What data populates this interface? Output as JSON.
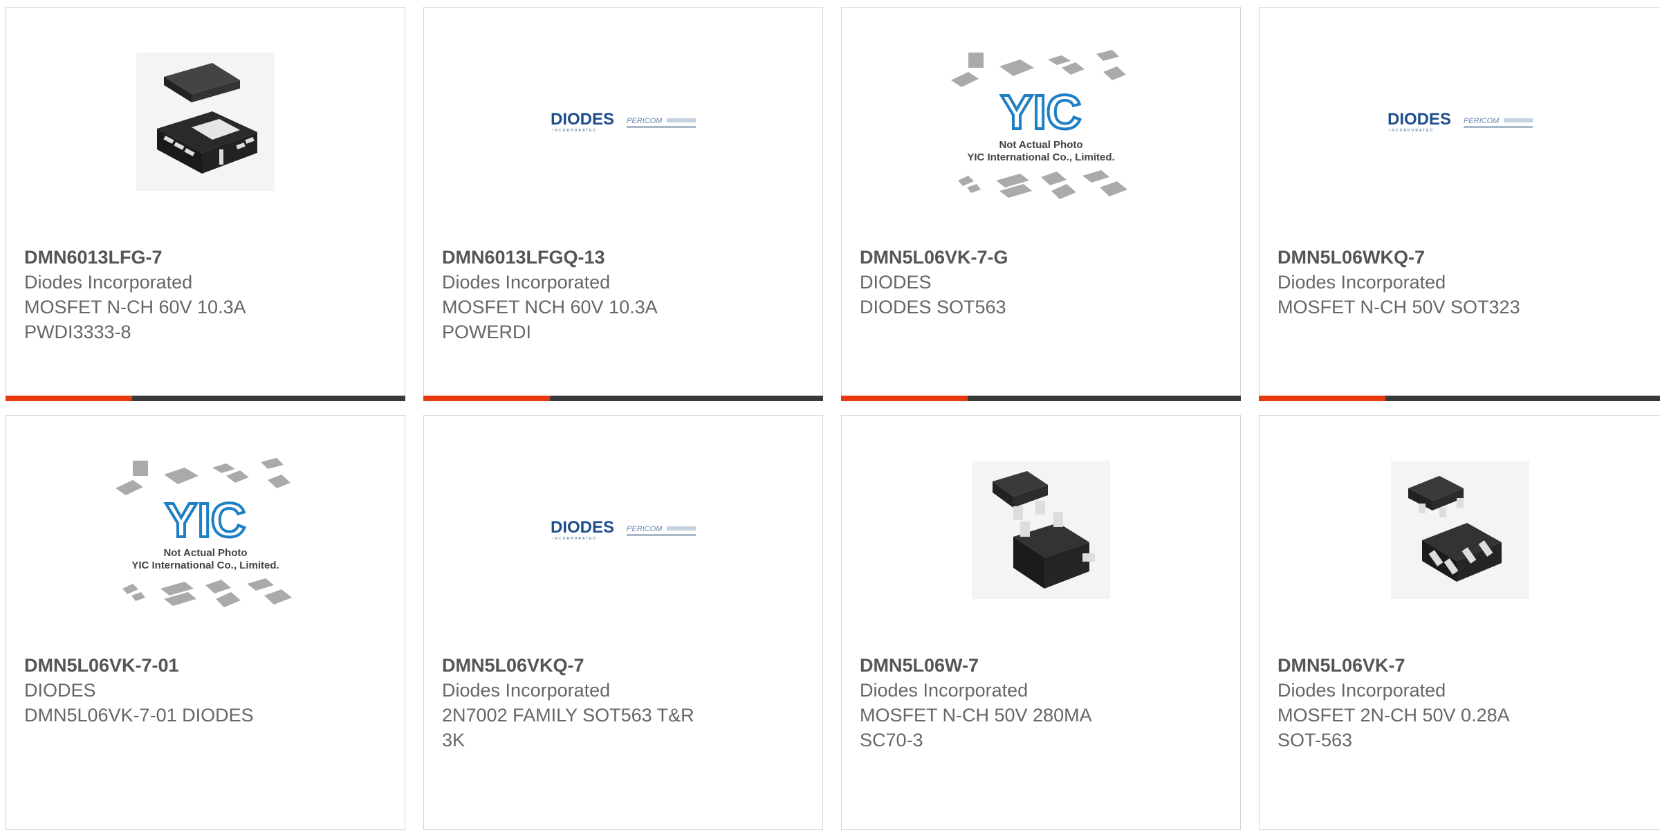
{
  "brand_colors": {
    "accent": "#e8380d",
    "bar": "#3a3a3a",
    "text": "#666666"
  },
  "products": [
    {
      "part": "DMN6013LFG-7",
      "maker": "Diodes Incorporated",
      "desc1": "MOSFET N-CH 60V 10.3A",
      "desc2": "PWDI3333-8",
      "image": "qfn-package-photo"
    },
    {
      "part": "DMN6013LFGQ-13",
      "maker": "Diodes Incorporated",
      "desc1": "MOSFET NCH 60V 10.3A",
      "desc2": "POWERDI",
      "image": "diodes-pericom-logo"
    },
    {
      "part": "DMN5L06VK-7-G",
      "maker": "DIODES",
      "desc1": "DIODES SOT563",
      "desc2": "",
      "image": "yic-not-actual-photo"
    },
    {
      "part": "DMN5L06WKQ-7",
      "maker": "Diodes Incorporated",
      "desc1": "MOSFET N-CH 50V SOT323",
      "desc2": "",
      "image": "diodes-pericom-logo"
    },
    {
      "part": "DMN5L06VK-7-01",
      "maker": "DIODES",
      "desc1": "DMN5L06VK-7-01 DIODES",
      "desc2": "",
      "image": "yic-not-actual-photo"
    },
    {
      "part": "DMN5L06VKQ-7",
      "maker": "Diodes Incorporated",
      "desc1": "2N7002 FAMILY SOT563 T&R",
      "desc2": "3K",
      "image": "diodes-pericom-logo"
    },
    {
      "part": "DMN5L06W-7",
      "maker": "Diodes Incorporated",
      "desc1": "MOSFET N-CH 50V 280MA",
      "desc2": "SC70-3",
      "image": "sot323-package-photo"
    },
    {
      "part": "DMN5L06VK-7",
      "maker": "Diodes Incorporated",
      "desc1": "MOSFET 2N-CH 50V 0.28A",
      "desc2": "SOT-563",
      "image": "sot563-package-photo"
    }
  ],
  "image_text": {
    "diodes_logo": "DIODES",
    "diodes_tagline": "INCORPORATED",
    "pericom_logo": "PERICOM",
    "yic_logo": "YIC",
    "yic_line1": "Not Actual Photo",
    "yic_line2": "YIC International Co., Limited."
  }
}
